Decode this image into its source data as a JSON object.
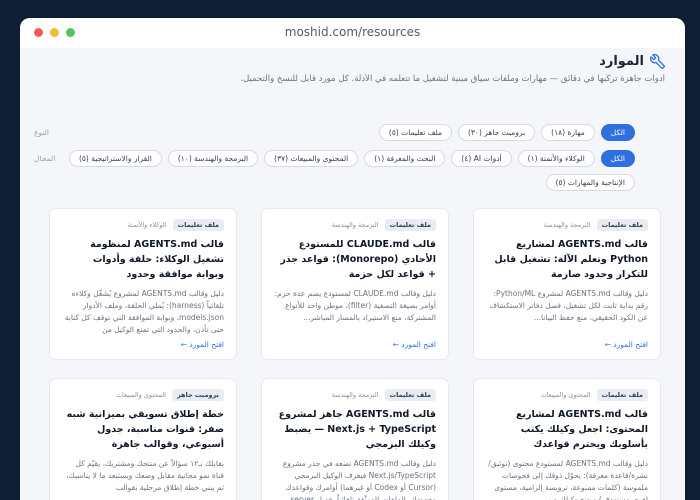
{
  "window": {
    "url": "moshid.com/resources"
  },
  "page": {
    "title": "الموارد",
    "subtitle": "أدوات جاهزة تركّبها في دقائق — مهارات وملفات سياق مبنية لتشغيل ما تتعلمه في الأدلة. كل مورد قابل للنسخ والتحميل."
  },
  "filters": {
    "type_label": "النوع",
    "type_options": [
      "الكل",
      "مهارة (١٨)",
      "برومبت جاهز (٣٠)",
      "ملف تعليمات (٥)"
    ],
    "domain_label": "المجال",
    "domain_options": [
      "الكل",
      "الوكلاء والأتمتة (١)",
      "أدوات AI (٤)",
      "البحث والمعرفة (١)",
      "المحتوى والمبيعات (٣٧)",
      "البرمجة والهندسة (١٠)",
      "القرار والاستراتيجية (٥)",
      "الإنتاجية والمهارات (٥)"
    ]
  },
  "cards": [
    {
      "type": "ملف تعليمات",
      "category": "البرمجة والهندسة",
      "title": "قالب AGENTS.md لمشاريع Python وتعلم الآلة: تشغيل قابل للتكرار وحدود صارمة",
      "desc": "دليل وقالب AGENTS.md لمشروع Python/ML: رقم بداية ثابت لكل تشغيل، فصل دفاتر الاستكشاف عن الكود الحقيقي، منع حفظ البيانا...",
      "link": "افتح المورد"
    },
    {
      "type": "ملف تعليمات",
      "category": "البرمجة والهندسة",
      "title": "قالب CLAUDE.md للمستودع الأحادي (Monorepo): قواعد جذر + قواعد لكل حزمة",
      "desc": "دليل وقالب CLAUDE.md لمستودع يضم عدة حزم: أوامر بصيغة التصفية (filter)، موطن واحد للأنواع المشتركة، منع الاستيراد بالمسار المباشر...",
      "link": "افتح المورد"
    },
    {
      "type": "ملف تعليمات",
      "category": "الوكلاء والأتمتة",
      "title": "قالب AGENTS.md لمنظومة تشغيل الوكلاء: حلقة وأدوات وبوابة موافقة وحدود",
      "desc": "دليل وقالب AGENTS.md لمشروع يُشغّل وكلاءه تلقائياً (harness): يُملي الحلقة، وملف الأدوار models.json، وبوابة الموافقة التي توقف كل كتابة حتى تأذن، والحدود التي تمنع الوكيل من",
      "link": "افتح المورد"
    },
    {
      "type": "ملف تعليمات",
      "category": "المحتوى والمبيعات",
      "title": "قالب AGENTS.md لمشاريع المحتوى: اجعل وكيلك يكتب بأسلوبك ويحترم قواعدك",
      "desc": "دليل وقالب AGENTS.md لمستودع محتوى (توثيق/نشرة/قاعدة معرفة): يحوّل ذوقك إلى فحوصات ملموسة (كلمات ممنوعة، ترويسة إلزامية، مستوى لغوي مستهدف) ويمنع وكيلك من",
      "link": ""
    },
    {
      "type": "ملف تعليمات",
      "category": "البرمجة والهندسة",
      "title": "قالب AGENTS.md جاهز لمشروع Next.js + TypeScript — يضبط وكيلك البرمجي",
      "desc": "دليل وقالب AGENTS.md تضعه في جذر مشروع Next.js/TypeScript فيعرف الوكيل البرمجي (Cursor أو Codex أو غيرهما) أوامرك وقواعدك وحدودك. الملفات الموثّقة تلقائياً، فصل server",
      "link": ""
    },
    {
      "type": "برومبت جاهز",
      "category": "المحتوى والمبيعات",
      "title": "خطة إطلاق تسويقي بميزانية شبه صفر: قنوات مناسبة، جدول أسبوعي، وقوالب جاهزة",
      "desc": "يقابلك بـ١٢ سؤالاً عن منتجك ومشتريك، يقيّم كل قناة نمو مجانية مقابل وضعك ويستبعد ما لا يناسبك، ثم يبني خطة إطلاق مرحلية بقوالب",
      "link": ""
    }
  ]
}
